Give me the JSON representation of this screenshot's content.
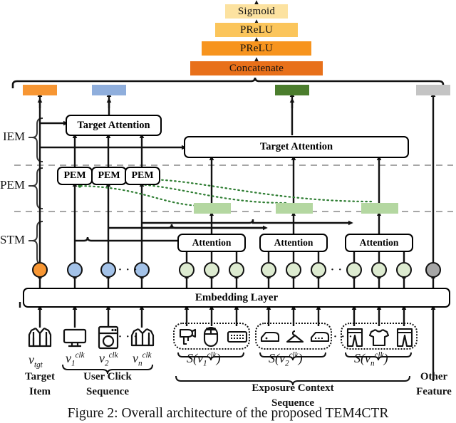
{
  "figure": {
    "caption": "Figure 2: Overall architecture of the proposed TEM4CTR"
  },
  "colors": {
    "orange_dark": "#E8701A",
    "orange_mid": "#F7941E",
    "orange_light": "#FBC55B",
    "yellow_light": "#FCE2A0",
    "bar_orange": "#F79633",
    "bar_blue": "#8FAEDC",
    "bar_green": "#4B7D2D",
    "bar_gray": "#C4C4C4",
    "circle_orange": "#F79633",
    "circle_blue": "#A3C2E8",
    "circle_green": "#DDEBD0",
    "circle_gray": "#A6A6A6",
    "green_bar": "#B4D7A1",
    "green_dotted": "#2E7D32",
    "dashed_gray": "#999999"
  },
  "mlp_stack": {
    "sigmoid": "Sigmoid",
    "prelu_top": "PReLU",
    "prelu_bottom": "PReLU",
    "concatenate": "Concatenate"
  },
  "module_labels": {
    "iem": "IEM",
    "pem": "PEM",
    "stm": "STM"
  },
  "blocks": {
    "target_attention_left": "Target Attention",
    "target_attention_right": "Target Attention",
    "pem_1": "PEM",
    "pem_2": "PEM",
    "pem_3": "PEM",
    "attention_1": "Attention",
    "attention_2": "Attention",
    "attention_3": "Attention",
    "embedding_layer": "Embedding Layer"
  },
  "ellipsis": "· · ·",
  "inputs": {
    "target": {
      "icon": "jacket-icon",
      "symbol_v": "v",
      "symbol_sub": "tgt",
      "caption_line1": "Target",
      "caption_line2": "Item"
    },
    "click_sequence": {
      "caption_line1": "User Click",
      "caption_line2": "Sequence",
      "items": [
        {
          "icon": "monitor-icon",
          "symbol_v": "v",
          "symbol_sub": "1",
          "symbol_sup": "clk"
        },
        {
          "icon": "washing-machine-icon",
          "symbol_v": "v",
          "symbol_sub": "2",
          "symbol_sup": "clk"
        },
        {
          "icon": "tshirt-icon",
          "symbol_v": "v",
          "symbol_sub": "n",
          "symbol_sup": "clk"
        }
      ]
    },
    "exposure_sequence": {
      "caption_line1": "Exposure Context",
      "caption_line2": "Sequence",
      "groups": [
        {
          "label_s": "S",
          "symbol_v": "v",
          "symbol_sub": "1",
          "symbol_sup": "clk",
          "icons": [
            "hairdryer-icon",
            "mouse-icon",
            "keyboard-icon"
          ]
        },
        {
          "label_s": "S",
          "symbol_v": "v",
          "symbol_sub": "2",
          "symbol_sup": "clk",
          "icons": [
            "iron-icon",
            "hanger-icon",
            "iron-icon"
          ]
        },
        {
          "label_s": "S",
          "symbol_v": "v",
          "symbol_sub": "n",
          "symbol_sup": "clk",
          "icons": [
            "pants-icon",
            "tshirt-icon",
            "pants-icon"
          ]
        }
      ]
    },
    "other_feature": {
      "caption_line1": "Other",
      "caption_line2": "Feature"
    }
  },
  "output_bars": [
    {
      "name": "target-item-representation",
      "color": "#F79633"
    },
    {
      "name": "click-sequence-representation",
      "color": "#8FAEDC"
    },
    {
      "name": "exposure-context-representation",
      "color": "#4B7D2D"
    },
    {
      "name": "other-feature-representation",
      "color": "#C4C4C4"
    }
  ]
}
